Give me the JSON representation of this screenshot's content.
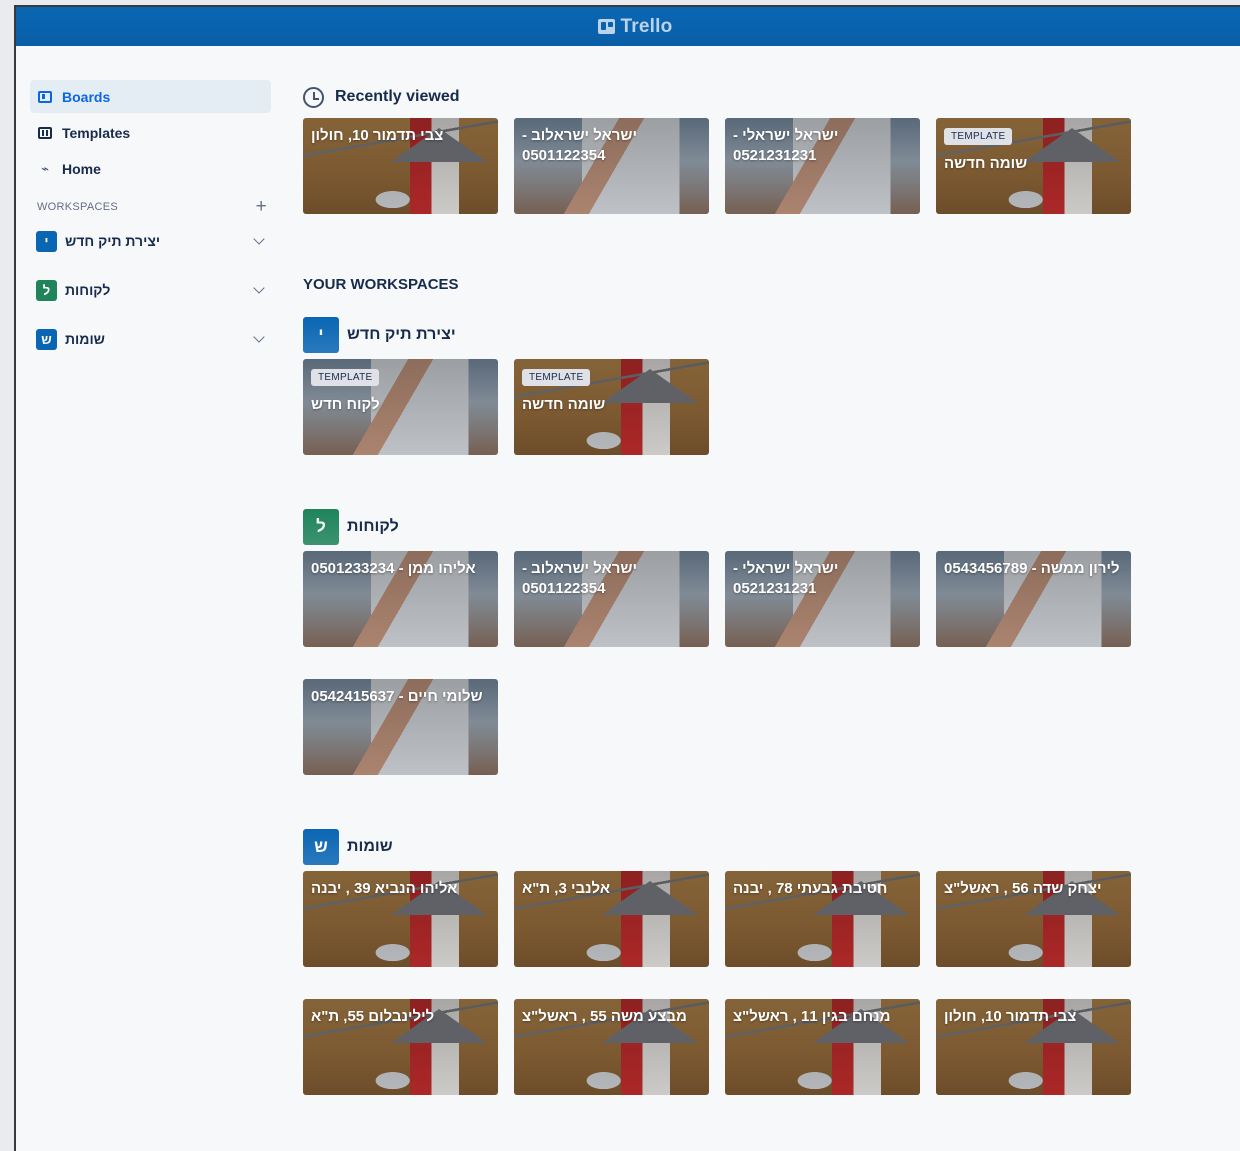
{
  "app": {
    "title": "Trello"
  },
  "sidebar": {
    "items": [
      {
        "label": "Boards",
        "icon": "board-icon",
        "active": true
      },
      {
        "label": "Templates",
        "icon": "template-icon",
        "active": false
      },
      {
        "label": "Home",
        "icon": "activity-icon",
        "active": false
      }
    ],
    "workspaces_heading": "WORKSPACES",
    "workspaces": [
      {
        "initial": "י",
        "name": "יצירת תיק חדש",
        "color": "#0a66b3"
      },
      {
        "initial": "ל",
        "name": "לקוחות",
        "color": "#1f845a"
      },
      {
        "initial": "ש",
        "name": "שומות",
        "color": "#0a66b3"
      }
    ]
  },
  "recently_viewed": {
    "title": "Recently viewed",
    "cards": [
      {
        "title": "צבי תדמור 10, חולון",
        "bg": "house",
        "template": false
      },
      {
        "title": "ישראל ישראלוב - 0501122354",
        "bg": "tablet",
        "template": false
      },
      {
        "title": "ישראל ישראלי - 0521231231",
        "bg": "tablet",
        "template": false
      },
      {
        "title": "שומה חדשה",
        "bg": "house",
        "template": true
      }
    ]
  },
  "your_workspaces": {
    "title": "YOUR WORKSPACES",
    "template_label": "TEMPLATE",
    "ws1": {
      "initial": "י",
      "name": "יצירת תיק חדש",
      "color": "#0a66b3",
      "cards": [
        {
          "title": "לקוח חדש",
          "bg": "tablet",
          "template": true
        },
        {
          "title": "שומה חדשה",
          "bg": "house",
          "template": true
        }
      ]
    },
    "ws2": {
      "initial": "ל",
      "name": "לקוחות",
      "color": "#1f845a",
      "cards": [
        {
          "title": "אליהו ממן - 0501233234",
          "bg": "tablet",
          "template": false
        },
        {
          "title": "ישראל ישראלוב - 0501122354",
          "bg": "tablet",
          "template": false
        },
        {
          "title": "ישראל ישראלי - 0521231231",
          "bg": "tablet",
          "template": false
        },
        {
          "title": "לירון ממשה - 0543456789",
          "bg": "tablet",
          "template": false
        },
        {
          "title": "שלומי חיים - 0542415637",
          "bg": "tablet",
          "template": false
        }
      ]
    },
    "ws3": {
      "initial": "ש",
      "name": "שומות",
      "color": "#0a66b3",
      "cards": [
        {
          "title": "אליהו הנביא 39 , יבנה",
          "bg": "house",
          "template": false
        },
        {
          "title": "אלנבי 3, ת\"א",
          "bg": "house",
          "template": false
        },
        {
          "title": "חטיבת גבעתי 78 , יבנה",
          "bg": "house",
          "template": false
        },
        {
          "title": "יצחק שדה 56 , ראשל\"צ",
          "bg": "house",
          "template": false
        },
        {
          "title": "לילינבלום 55, ת\"א",
          "bg": "house",
          "template": false
        },
        {
          "title": "מבצע משה 55 , ראשל\"צ",
          "bg": "house",
          "template": false
        },
        {
          "title": "מנחם בגין 11 , ראשל\"צ",
          "bg": "house",
          "template": false
        },
        {
          "title": "צבי תדמור 10, חולון",
          "bg": "house",
          "template": false
        }
      ]
    }
  }
}
